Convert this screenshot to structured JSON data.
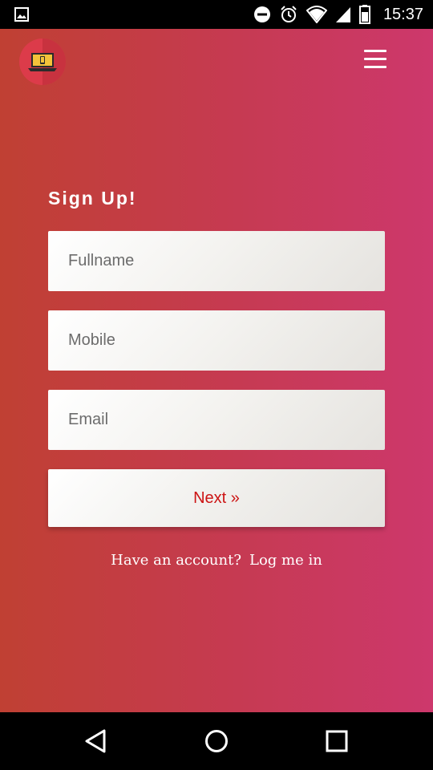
{
  "status_bar": {
    "time": "15:37",
    "icons": [
      "image-icon",
      "do-not-disturb-icon",
      "alarm-icon",
      "wifi-icon",
      "signal-icon",
      "battery-icon"
    ]
  },
  "header": {
    "logo_icon": "laptop-icon",
    "menu_icon": "hamburger-menu-icon"
  },
  "form": {
    "title": "Sign Up!",
    "fullname_placeholder": "Fullname",
    "mobile_placeholder": "Mobile",
    "email_placeholder": "Email",
    "next_label": "Next »"
  },
  "footer": {
    "prompt": "Have an account?",
    "login_link": "Log me in"
  },
  "nav_bar": {
    "icons": [
      "back-icon",
      "home-icon",
      "recent-apps-icon"
    ]
  },
  "colors": {
    "gradient_start": "#c04033",
    "gradient_end": "#cd386c",
    "accent_text": "#cc1414"
  }
}
